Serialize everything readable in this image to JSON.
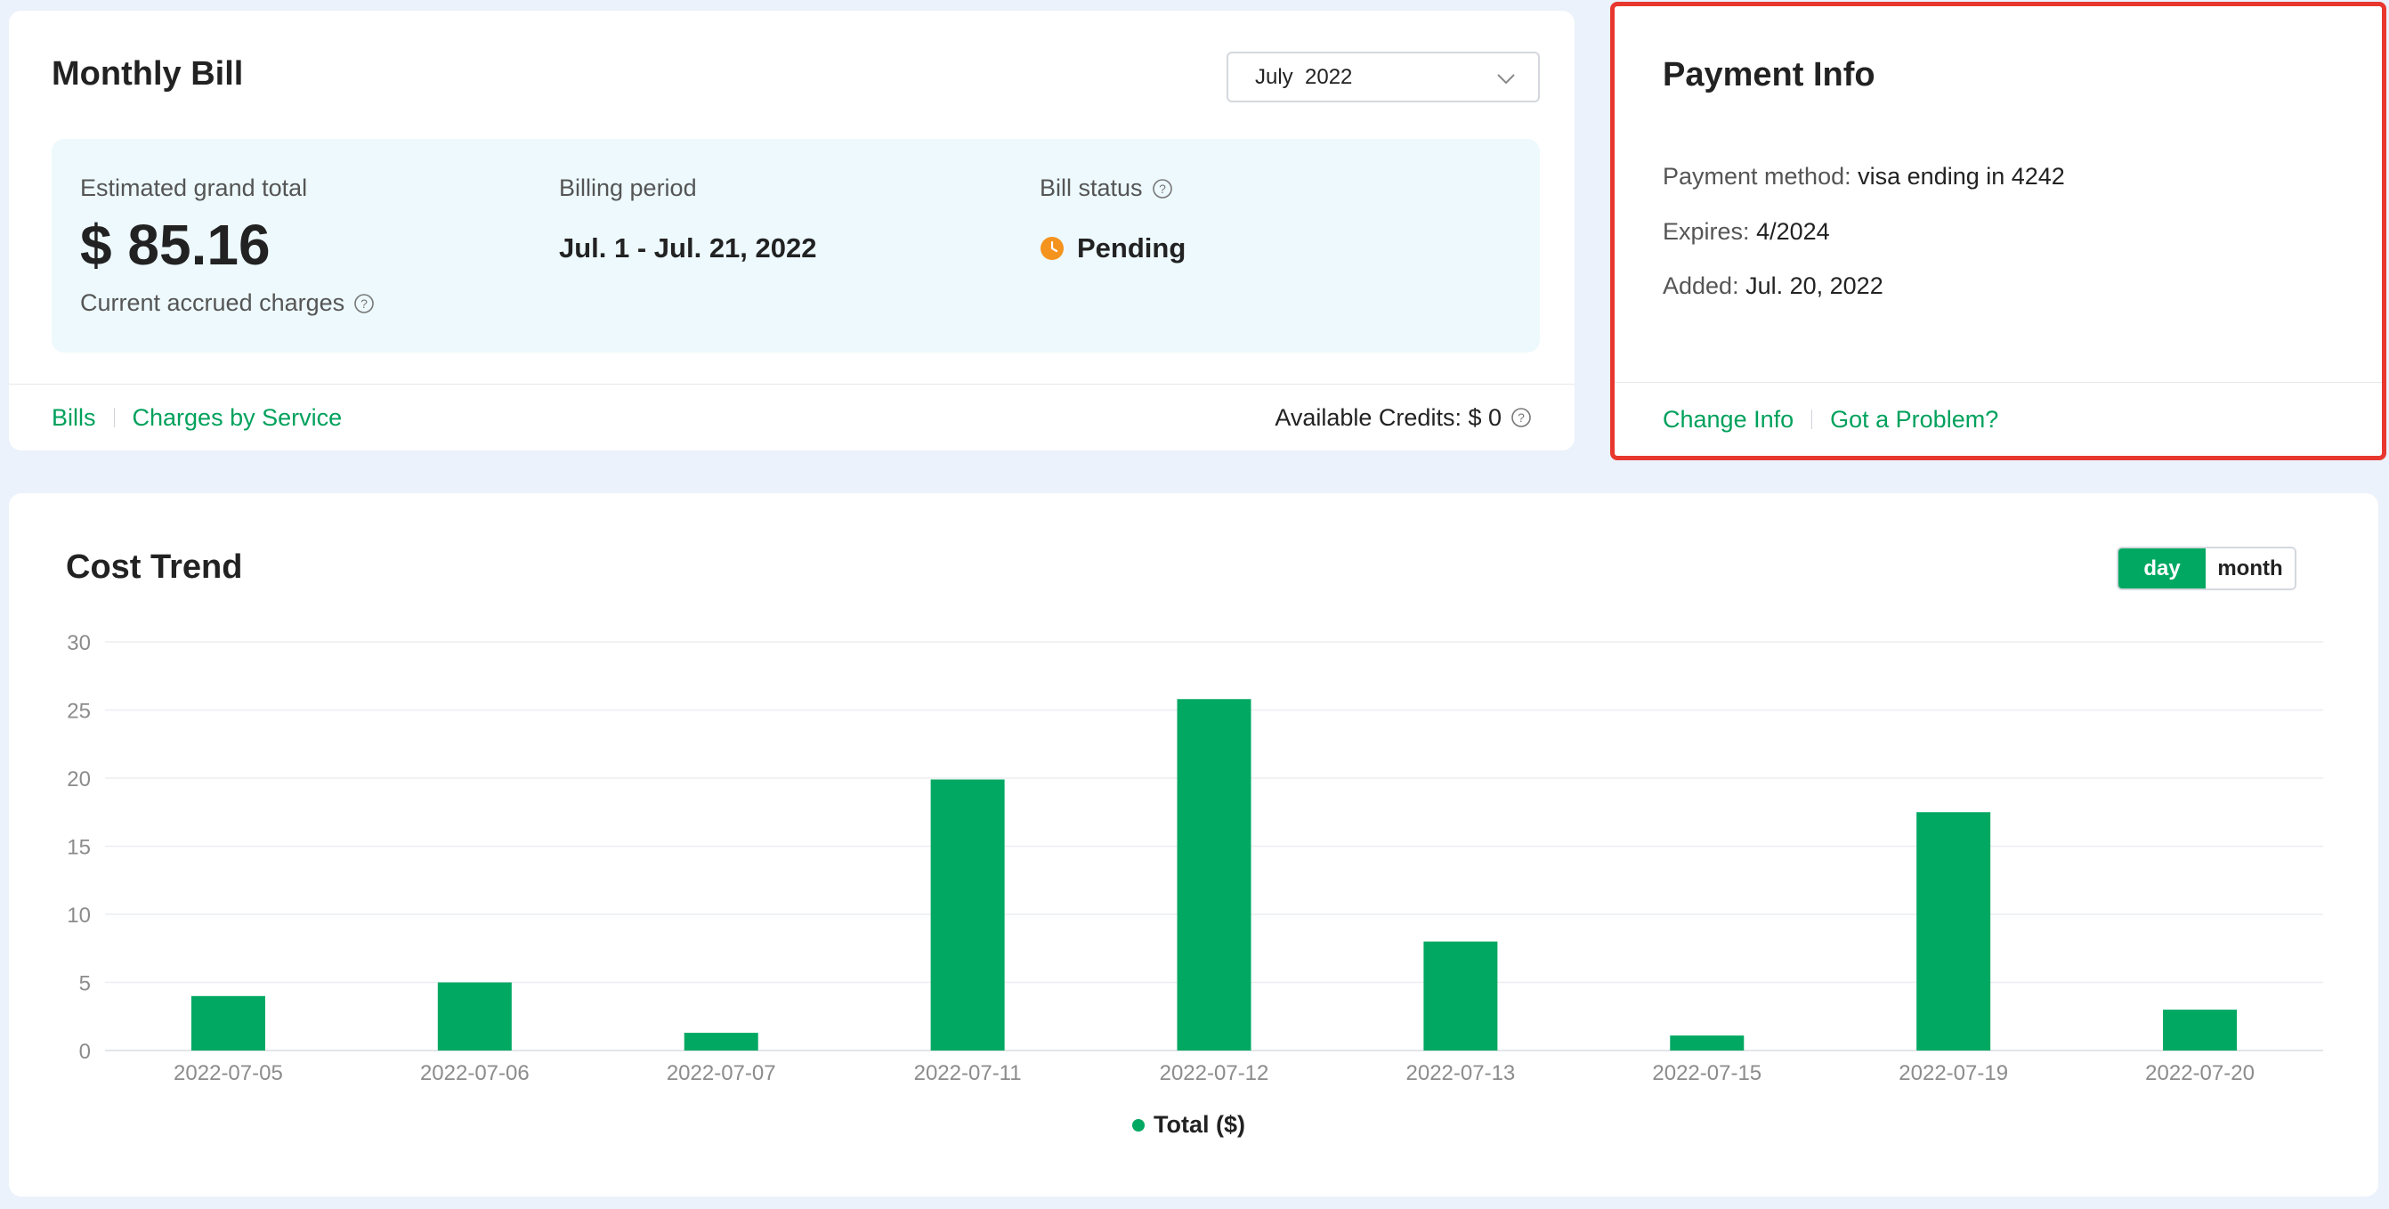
{
  "monthly_bill": {
    "title": "Monthly Bill",
    "month_select": "July  2022",
    "estimated_label": "Estimated grand total",
    "estimated_value": "$ 85.16",
    "accrued_label": "Current accrued charges",
    "period_label": "Billing period",
    "period_value": "Jul. 1 - Jul. 21, 2022",
    "status_label": "Bill status",
    "status_value": "Pending",
    "status_color": "#f5931f",
    "links": [
      "Bills",
      "Charges by Service"
    ],
    "credits": "Available Credits: $ 0"
  },
  "payment": {
    "title": "Payment Info",
    "method_label": "Payment method:",
    "method_value": "visa ending in 4242",
    "expires_label": "Expires:",
    "expires_value": "4/2024",
    "added_label": "Added:",
    "added_value": "Jul. 20, 2022",
    "links": [
      "Change Info",
      "Got a Problem?"
    ],
    "highlight_color": "#e8372e"
  },
  "cost_trend": {
    "title": "Cost Trend",
    "toggle": [
      "day",
      "month"
    ],
    "active_toggle": "day",
    "accent": "#00a862"
  },
  "chart_data": {
    "type": "bar",
    "categories": [
      "2022-07-05",
      "2022-07-06",
      "2022-07-07",
      "2022-07-11",
      "2022-07-12",
      "2022-07-13",
      "2022-07-15",
      "2022-07-19",
      "2022-07-20"
    ],
    "series": [
      {
        "name": "Total ($)",
        "values": [
          4.0,
          5.0,
          1.3,
          19.9,
          25.8,
          8.0,
          1.1,
          17.5,
          3.0
        ]
      }
    ],
    "yticks": [
      0,
      5,
      10,
      15,
      20,
      25,
      30
    ],
    "ylim": [
      0,
      30
    ],
    "grid": true,
    "legend": "bottom-center",
    "color": "#00a862"
  }
}
